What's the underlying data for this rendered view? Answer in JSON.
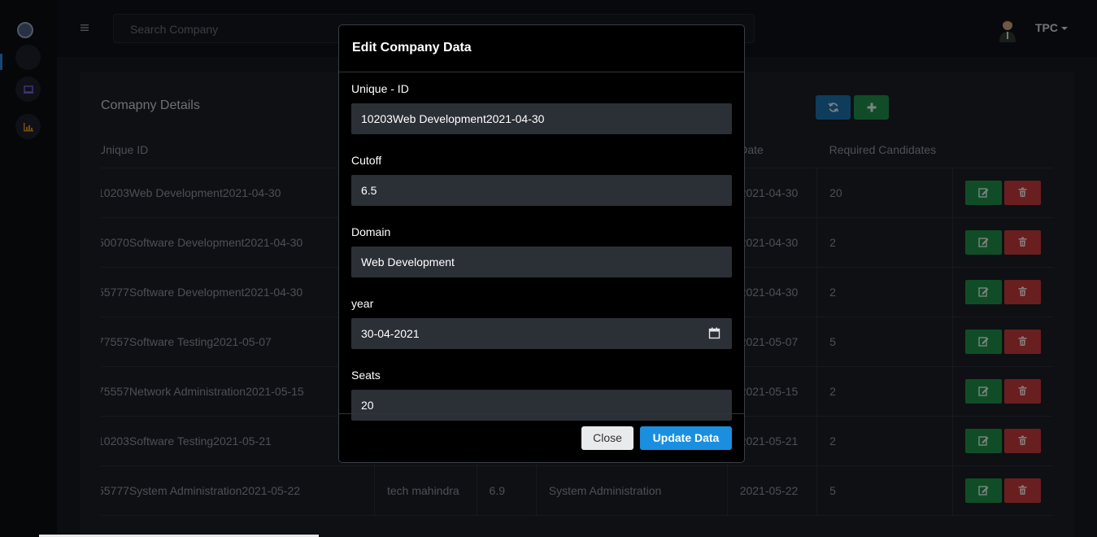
{
  "topbar": {
    "search_placeholder": "Search Company",
    "user_label": "TPC"
  },
  "card": {
    "title": "Comapny Details",
    "columns": [
      "Unique ID",
      "",
      "",
      "",
      "Date",
      "Required Candidates",
      ""
    ],
    "rows": [
      {
        "id": "10203Web Development2021-04-30",
        "company": "",
        "cutoff": "",
        "domain": "",
        "date": "2021-04-30",
        "required": "20"
      },
      {
        "id": "50070Software Development2021-04-30",
        "company": "",
        "cutoff": "",
        "domain": "",
        "date": "2021-04-30",
        "required": "2"
      },
      {
        "id": "55777Software Development2021-04-30",
        "company": "",
        "cutoff": "",
        "domain": "",
        "date": "2021-04-30",
        "required": "2"
      },
      {
        "id": "77557Software Testing2021-05-07",
        "company": "",
        "cutoff": "",
        "domain": "",
        "date": "2021-05-07",
        "required": "5"
      },
      {
        "id": "75557Network Administration2021-05-15",
        "company": "",
        "cutoff": "",
        "domain": "",
        "date": "2021-05-15",
        "required": "2"
      },
      {
        "id": "10203Software Testing2021-05-21",
        "company": "",
        "cutoff": "",
        "domain": "",
        "date": "2021-05-21",
        "required": "2"
      },
      {
        "id": "55777System Administration2021-05-22",
        "company": "tech mahindra",
        "cutoff": "6.9",
        "domain": "System Administration",
        "date": "2021-05-22",
        "required": "5"
      }
    ]
  },
  "modal": {
    "title": "Edit Company Data",
    "fields": [
      {
        "label": "Unique - ID",
        "value": "10203Web Development2021-04-30"
      },
      {
        "label": "Cutoff",
        "value": "6.5"
      },
      {
        "label": "Domain",
        "value": "Web Development"
      },
      {
        "label": "year",
        "value": "30-04-2021"
      },
      {
        "label": "Seats",
        "value": "20"
      }
    ],
    "close_label": "Close",
    "update_label": "Update Data"
  },
  "colors": {
    "accent": "#1a8fe0",
    "edit": "#1e8d47",
    "delete": "#c03a3a",
    "refresh": "#1c6ea4"
  }
}
